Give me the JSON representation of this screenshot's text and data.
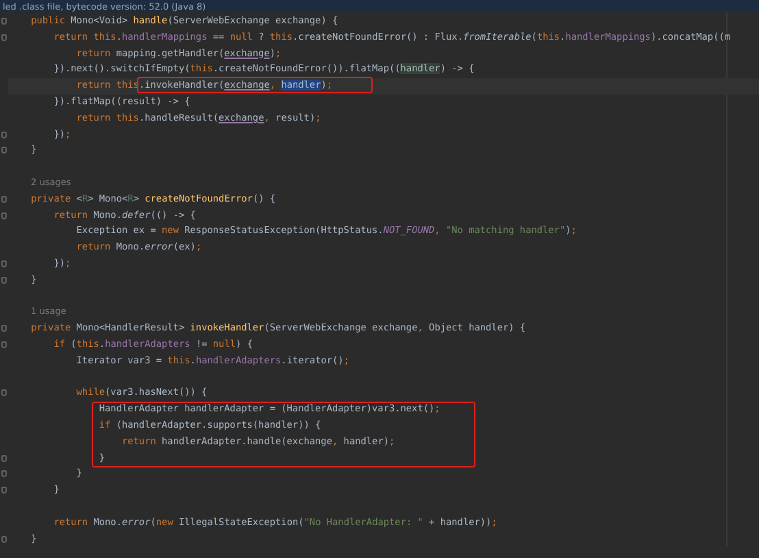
{
  "banner": {
    "text": "led .class file, bytecode version: 52.0 (Java 8)"
  },
  "code": [
    {
      "kind": "line",
      "fold": true,
      "tokens": [
        {
          "t": "    public ",
          "kind": "keyword"
        },
        {
          "t": "Mono<Void> ",
          "kind": "plain"
        },
        {
          "t": "handle",
          "kind": "declaration"
        },
        {
          "t": "(ServerWebExchange exchange) {",
          "kind": "plain"
        }
      ]
    },
    {
      "kind": "line",
      "fold": true,
      "tokens": [
        {
          "t": "        return ",
          "kind": "keyword"
        },
        {
          "t": "this",
          "kind": "keyword"
        },
        {
          "t": ".",
          "kind": "plain"
        },
        {
          "t": "handlerMappings",
          "kind": "field"
        },
        {
          "t": " == ",
          "kind": "plain"
        },
        {
          "t": "null",
          "kind": "keyword"
        },
        {
          "t": " ? ",
          "kind": "plain"
        },
        {
          "t": "this",
          "kind": "keyword"
        },
        {
          "t": ".createNotFoundError() : Flux.",
          "kind": "plain"
        },
        {
          "t": "fromIterable",
          "kind": "static"
        },
        {
          "t": "(",
          "kind": "plain"
        },
        {
          "t": "this",
          "kind": "keyword"
        },
        {
          "t": ".",
          "kind": "plain"
        },
        {
          "t": "handlerMappings",
          "kind": "field"
        },
        {
          "t": ").concatMap((m",
          "kind": "plain"
        }
      ]
    },
    {
      "kind": "line",
      "fold": false,
      "tokens": [
        {
          "t": "            return ",
          "kind": "keyword"
        },
        {
          "t": "mapping.getHandler(",
          "kind": "plain"
        },
        {
          "t": "exchange",
          "kind": "parameter"
        },
        {
          "t": ")",
          "kind": "plain"
        },
        {
          "t": ";",
          "kind": "keyword"
        }
      ]
    },
    {
      "kind": "line",
      "fold": false,
      "tokens": [
        {
          "t": "        }).next().switchIfEmpty(",
          "kind": "plain"
        },
        {
          "t": "this",
          "kind": "keyword"
        },
        {
          "t": ".createNotFoundError()).flatMap((",
          "kind": "plain"
        },
        {
          "t": "handler",
          "kind": "match"
        },
        {
          "t": ") -> {",
          "kind": "plain"
        }
      ]
    },
    {
      "kind": "current-line",
      "fold": false,
      "segments": [
        {
          "boxed": false,
          "tokens": [
            {
              "t": "            return ",
              "kind": "keyword"
            },
            {
              "t": "this",
              "kind": "keyword"
            }
          ]
        },
        {
          "boxed": true,
          "tokens": [
            {
              "t": ".invokeHandler(",
              "kind": "plain"
            },
            {
              "t": "exchange",
              "kind": "parameter"
            },
            {
              "t": ", ",
              "kind": "keyword"
            },
            {
              "t": "handler",
              "kind": "selection"
            },
            {
              "t": ")",
              "kind": "plain"
            },
            {
              "t": ";",
              "kind": "keyword"
            }
          ]
        }
      ]
    },
    {
      "kind": "line",
      "fold": false,
      "tokens": [
        {
          "t": "        }).flatMap((result) -> {",
          "kind": "plain"
        }
      ]
    },
    {
      "kind": "line",
      "fold": false,
      "tokens": [
        {
          "t": "            return ",
          "kind": "keyword"
        },
        {
          "t": "this",
          "kind": "keyword"
        },
        {
          "t": ".handleResult(",
          "kind": "plain"
        },
        {
          "t": "exchange",
          "kind": "parameter"
        },
        {
          "t": ", ",
          "kind": "keyword"
        },
        {
          "t": "result)",
          "kind": "plain"
        },
        {
          "t": ";",
          "kind": "keyword"
        }
      ]
    },
    {
      "kind": "line",
      "fold": true,
      "tokens": [
        {
          "t": "        })",
          "kind": "plain"
        },
        {
          "t": ";",
          "kind": "keyword"
        }
      ]
    },
    {
      "kind": "line",
      "fold": true,
      "tokens": [
        {
          "t": "    }",
          "kind": "plain"
        }
      ]
    },
    {
      "kind": "blank"
    },
    {
      "kind": "hint",
      "text": "2 usages"
    },
    {
      "kind": "line",
      "fold": true,
      "tokens": [
        {
          "t": "    private ",
          "kind": "keyword"
        },
        {
          "t": "<",
          "kind": "plain"
        },
        {
          "t": "R",
          "kind": "type-parameter"
        },
        {
          "t": "> Mono<",
          "kind": "plain"
        },
        {
          "t": "R",
          "kind": "type-parameter"
        },
        {
          "t": "> ",
          "kind": "plain"
        },
        {
          "t": "createNotFoundError",
          "kind": "declaration"
        },
        {
          "t": "() {",
          "kind": "plain"
        }
      ]
    },
    {
      "kind": "line",
      "fold": true,
      "tokens": [
        {
          "t": "        return ",
          "kind": "keyword"
        },
        {
          "t": "Mono.",
          "kind": "plain"
        },
        {
          "t": "defer",
          "kind": "static"
        },
        {
          "t": "(() -> {",
          "kind": "plain"
        }
      ]
    },
    {
      "kind": "line",
      "fold": false,
      "tokens": [
        {
          "t": "            Exception ex = ",
          "kind": "plain"
        },
        {
          "t": "new ",
          "kind": "keyword"
        },
        {
          "t": "ResponseStatusException(HttpStatus.",
          "kind": "plain"
        },
        {
          "t": "NOT_FOUND",
          "kind": "constant"
        },
        {
          "t": ", ",
          "kind": "keyword"
        },
        {
          "t": "\"No matching handler\"",
          "kind": "string"
        },
        {
          "t": ")",
          "kind": "plain"
        },
        {
          "t": ";",
          "kind": "keyword"
        }
      ]
    },
    {
      "kind": "line",
      "fold": false,
      "tokens": [
        {
          "t": "            return ",
          "kind": "keyword"
        },
        {
          "t": "Mono.",
          "kind": "plain"
        },
        {
          "t": "error",
          "kind": "static"
        },
        {
          "t": "(ex)",
          "kind": "plain"
        },
        {
          "t": ";",
          "kind": "keyword"
        }
      ]
    },
    {
      "kind": "line",
      "fold": true,
      "tokens": [
        {
          "t": "        })",
          "kind": "plain"
        },
        {
          "t": ";",
          "kind": "keyword"
        }
      ]
    },
    {
      "kind": "line",
      "fold": true,
      "tokens": [
        {
          "t": "    }",
          "kind": "plain"
        }
      ]
    },
    {
      "kind": "blank"
    },
    {
      "kind": "hint",
      "text": "1 usage"
    },
    {
      "kind": "line",
      "fold": true,
      "tokens": [
        {
          "t": "    private ",
          "kind": "keyword"
        },
        {
          "t": "Mono<HandlerResult> ",
          "kind": "plain"
        },
        {
          "t": "invokeHandler",
          "kind": "declaration"
        },
        {
          "t": "(ServerWebExchange exchange",
          "kind": "plain"
        },
        {
          "t": ", ",
          "kind": "keyword"
        },
        {
          "t": "Object handler) {",
          "kind": "plain"
        }
      ]
    },
    {
      "kind": "line",
      "fold": true,
      "tokens": [
        {
          "t": "        if ",
          "kind": "keyword"
        },
        {
          "t": "(",
          "kind": "plain"
        },
        {
          "t": "this",
          "kind": "keyword"
        },
        {
          "t": ".",
          "kind": "plain"
        },
        {
          "t": "handlerAdapters",
          "kind": "field"
        },
        {
          "t": " != ",
          "kind": "plain"
        },
        {
          "t": "null",
          "kind": "keyword"
        },
        {
          "t": ") {",
          "kind": "plain"
        }
      ]
    },
    {
      "kind": "line",
      "fold": false,
      "tokens": [
        {
          "t": "            Iterator var3 = ",
          "kind": "plain"
        },
        {
          "t": "this",
          "kind": "keyword"
        },
        {
          "t": ".",
          "kind": "plain"
        },
        {
          "t": "handlerAdapters",
          "kind": "field"
        },
        {
          "t": ".iterator()",
          "kind": "plain"
        },
        {
          "t": ";",
          "kind": "keyword"
        }
      ]
    },
    {
      "kind": "blank"
    },
    {
      "kind": "line",
      "fold": true,
      "tokens": [
        {
          "t": "            while",
          "kind": "keyword"
        },
        {
          "t": "(var3.hasNext()) {",
          "kind": "plain"
        }
      ]
    },
    {
      "kind": "boxed-group",
      "lines": [
        {
          "kind": "line",
          "fold": false,
          "tokens": [
            {
              "t": "                HandlerAdapter handlerAdapter = (HandlerAdapter)var3.next()",
              "kind": "plain"
            },
            {
              "t": ";",
              "kind": "keyword"
            }
          ]
        },
        {
          "kind": "line",
          "fold": false,
          "tokens": [
            {
              "t": "                if ",
              "kind": "keyword"
            },
            {
              "t": "(handlerAdapter.supports(handler)) {",
              "kind": "plain"
            }
          ]
        },
        {
          "kind": "line",
          "fold": false,
          "tokens": [
            {
              "t": "                    return ",
              "kind": "keyword"
            },
            {
              "t": "handlerAdapter.handle(exchange",
              "kind": "plain"
            },
            {
              "t": ", ",
              "kind": "keyword"
            },
            {
              "t": "handler)",
              "kind": "plain"
            },
            {
              "t": ";",
              "kind": "keyword"
            }
          ]
        },
        {
          "kind": "line",
          "fold": true,
          "tokens": [
            {
              "t": "                }",
              "kind": "plain"
            }
          ]
        }
      ]
    },
    {
      "kind": "line",
      "fold": true,
      "tokens": [
        {
          "t": "            }",
          "kind": "plain"
        }
      ]
    },
    {
      "kind": "line",
      "fold": true,
      "tokens": [
        {
          "t": "        }",
          "kind": "plain"
        }
      ]
    },
    {
      "kind": "blank"
    },
    {
      "kind": "line",
      "fold": false,
      "tokens": [
        {
          "t": "        return ",
          "kind": "keyword"
        },
        {
          "t": "Mono.",
          "kind": "plain"
        },
        {
          "t": "error",
          "kind": "static"
        },
        {
          "t": "(",
          "kind": "plain"
        },
        {
          "t": "new ",
          "kind": "keyword"
        },
        {
          "t": "IllegalStateException(",
          "kind": "plain"
        },
        {
          "t": "\"No HandlerAdapter: \"",
          "kind": "string"
        },
        {
          "t": " + handler))",
          "kind": "plain"
        },
        {
          "t": ";",
          "kind": "keyword"
        }
      ]
    },
    {
      "kind": "line",
      "fold": true,
      "tokens": [
        {
          "t": "    }",
          "kind": "plain"
        }
      ]
    }
  ]
}
